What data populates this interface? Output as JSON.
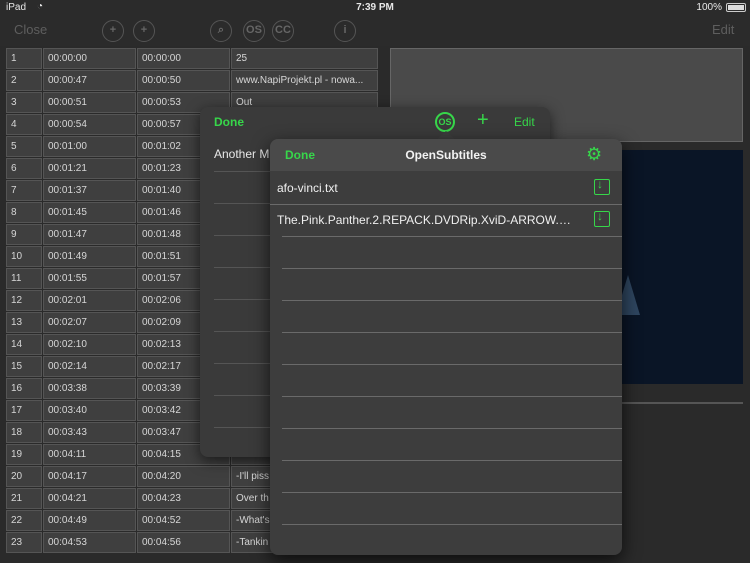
{
  "status_bar": {
    "carrier": "iPad",
    "time": "7:39 PM",
    "battery": "100%"
  },
  "toolbar": {
    "close_label": "Close",
    "edit_label": "Edit",
    "cc_label": "CC",
    "os_label": "OS"
  },
  "table": {
    "rows": [
      [
        "1",
        "00:00:00",
        "00:00:00",
        "25"
      ],
      [
        "2",
        "00:00:47",
        "00:00:50",
        "www.NapiProjekt.pl - nowa..."
      ],
      [
        "3",
        "00:00:51",
        "00:00:53",
        "Out"
      ],
      [
        "4",
        "00:00:54",
        "00:00:57",
        ""
      ],
      [
        "5",
        "00:01:00",
        "00:01:02",
        ""
      ],
      [
        "6",
        "00:01:21",
        "00:01:23",
        ""
      ],
      [
        "7",
        "00:01:37",
        "00:01:40",
        ""
      ],
      [
        "8",
        "00:01:45",
        "00:01:46",
        ""
      ],
      [
        "9",
        "00:01:47",
        "00:01:48",
        ""
      ],
      [
        "10",
        "00:01:49",
        "00:01:51",
        ""
      ],
      [
        "11",
        "00:01:55",
        "00:01:57",
        ""
      ],
      [
        "12",
        "00:02:01",
        "00:02:06",
        ""
      ],
      [
        "13",
        "00:02:07",
        "00:02:09",
        ""
      ],
      [
        "14",
        "00:02:10",
        "00:02:13",
        ""
      ],
      [
        "15",
        "00:02:14",
        "00:02:17",
        ""
      ],
      [
        "16",
        "00:03:38",
        "00:03:39",
        ""
      ],
      [
        "17",
        "00:03:40",
        "00:03:42",
        ""
      ],
      [
        "18",
        "00:03:43",
        "00:03:47",
        ""
      ],
      [
        "19",
        "00:04:11",
        "00:04:15",
        ""
      ],
      [
        "20",
        "00:04:17",
        "00:04:20",
        "-I'll piss"
      ],
      [
        "21",
        "00:04:21",
        "00:04:23",
        "Over th"
      ],
      [
        "22",
        "00:04:49",
        "00:04:52",
        "-What's"
      ],
      [
        "23",
        "00:04:53",
        "00:04:56",
        "-Tankin"
      ]
    ]
  },
  "popover_back": {
    "done_label": "Done",
    "os_label": "OS",
    "add_label": "+",
    "edit_label": "Edit",
    "item": "Another M"
  },
  "popover_front": {
    "done_label": "Done",
    "title": "OpenSubtitles",
    "files": [
      "afo-vinci.txt",
      "The.Pink.Panther.2.REPACK.DVDRip.XviD-ARROW.en..."
    ]
  },
  "colors": {
    "accent": "#37d64a",
    "background": "#2a2a2a"
  }
}
